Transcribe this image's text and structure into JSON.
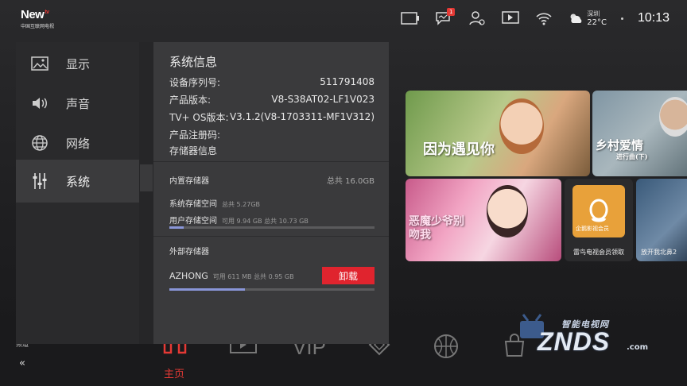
{
  "logo": {
    "brand": "New",
    "brand_sup": "tv",
    "sub": "中国互联网电视"
  },
  "status": {
    "notification_count": "1",
    "city": "深圳",
    "temperature": "22°C",
    "time": "10:13"
  },
  "settings_menu": {
    "items": [
      {
        "label": "显示",
        "icon": "image-icon"
      },
      {
        "label": "声音",
        "icon": "speaker-icon"
      },
      {
        "label": "网络",
        "icon": "globe-icon"
      },
      {
        "label": "系统",
        "icon": "sliders-icon"
      }
    ],
    "active": "系统"
  },
  "system_info": {
    "title": "系统信息",
    "rows": [
      {
        "label": "设备序列号:",
        "value": "511791408"
      },
      {
        "label": "产品版本:",
        "value": "V8-S38AT02-LF1V023"
      },
      {
        "label": "TV+ OS版本:",
        "value": "V3.1.2(V8-1703311-MF1V312)"
      },
      {
        "label": "产品注册码:",
        "value": ""
      },
      {
        "label": "存储器信息",
        "value": ""
      }
    ],
    "internal": {
      "title": "内置存储器",
      "total": "总共 16.0GB",
      "system_label": "系统存储空间",
      "system_info": "总共 5.27GB",
      "user_label": "用户存储空间",
      "user_info": "可用 9.94 GB  总共 10.73 GB",
      "user_used_fraction": 0.07
    },
    "external": {
      "title": "外部存储器",
      "device": "AZHONG",
      "info": "可用 611 MB  总共 0.95 GB",
      "button": "卸载",
      "used_fraction": 0.37
    }
  },
  "tiles": [
    {
      "title": "因为遇见你"
    },
    {
      "title": "乡村爱情",
      "sub": "进行曲(下)"
    },
    {
      "title": "恶魔少爷别吻我"
    },
    {
      "label": "企鹅影视会员",
      "caption": "雷鸟电视会员领取"
    },
    {
      "caption": "放开我北鼻2"
    }
  ],
  "bottom_nav": {
    "active_label": "主页",
    "side_label": "频道",
    "back": "«"
  },
  "watermark": {
    "top": "智能电视网",
    "main": "ZNDS",
    "suffix": ".com"
  }
}
